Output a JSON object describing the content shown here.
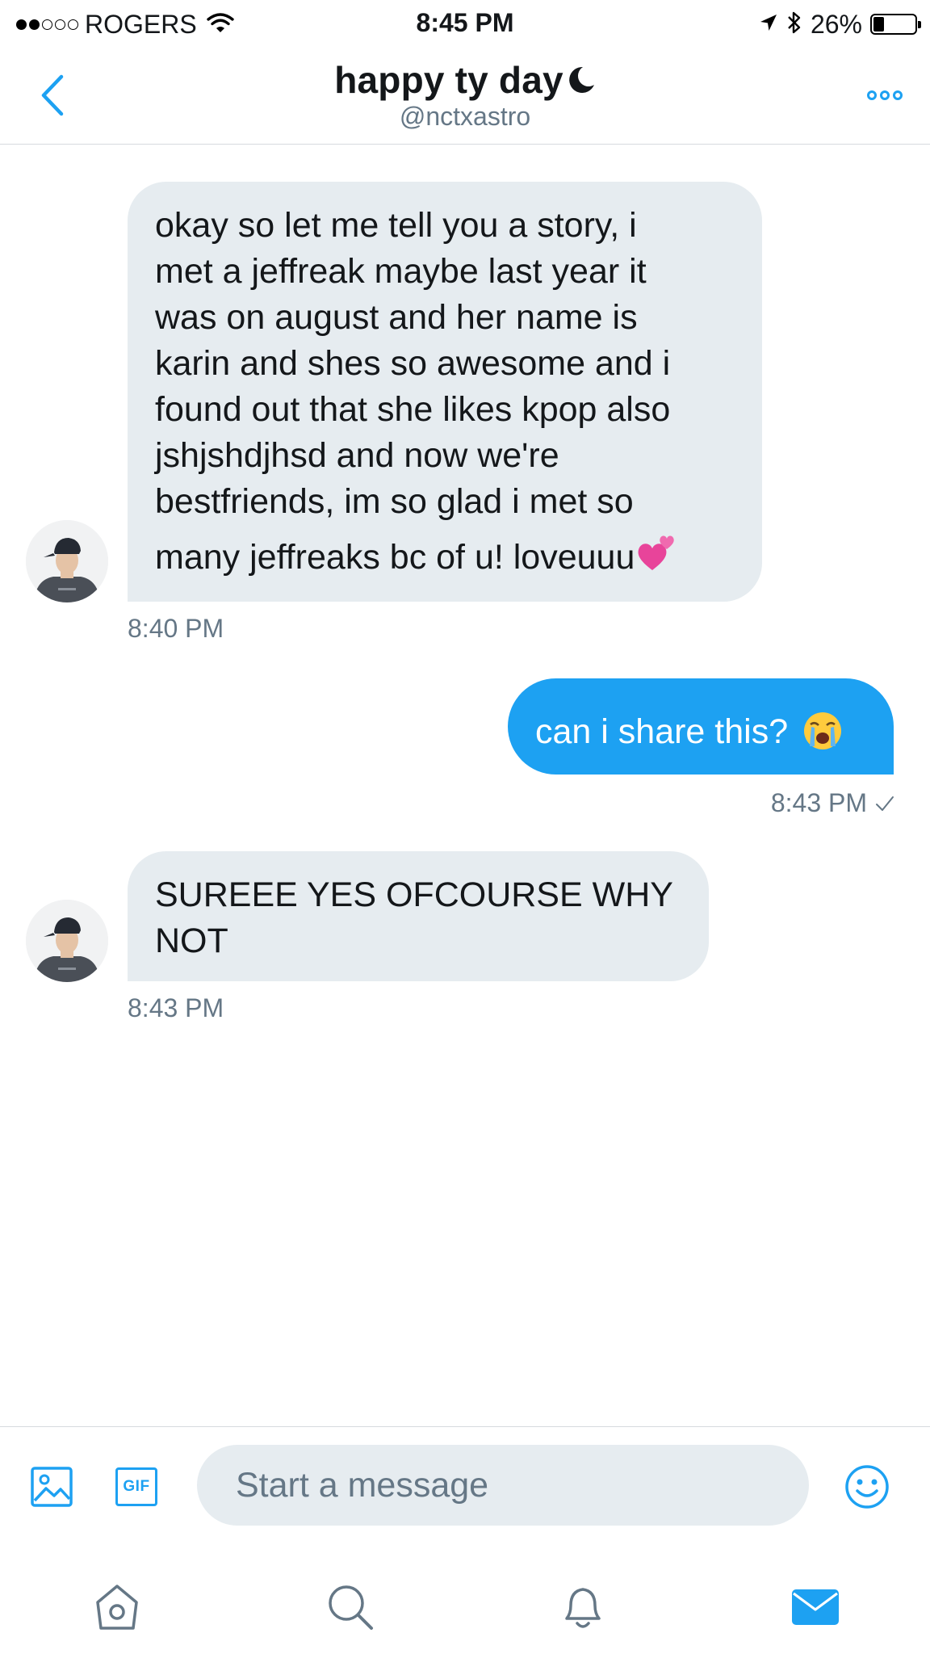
{
  "status_bar": {
    "carrier": "ROGERS",
    "signal_bars_full": 2,
    "signal_bars_total": 5,
    "time": "8:45 PM",
    "battery_percent": "26%",
    "battery_level": 0.26,
    "icons": [
      "wifi-icon",
      "location-arrow-icon",
      "bluetooth-icon",
      "battery-icon"
    ]
  },
  "header": {
    "title": "happy ty day",
    "title_suffix_icon": "crescent-moon-icon",
    "handle": "@nctxastro",
    "back_icon": "chevron-left-icon",
    "more_icon": "more-dots-icon"
  },
  "messages": [
    {
      "direction": "incoming",
      "lines": [
        "okay so let me tell you a story, i",
        "met a jeffreak maybe last year it",
        "was on august and her name is",
        "karin and shes so awesome and i",
        "found out that she likes kpop also",
        "jshjshdjhsd and now we're",
        "bestfriends, im so glad i met so",
        "many jeffreaks bc of u! loveuuu"
      ],
      "emoji": "two-hearts-emoji",
      "time": "8:40 PM"
    },
    {
      "direction": "outgoing",
      "text": "can i share this?",
      "emoji": "loudly-crying-face-emoji",
      "time": "8:43 PM",
      "status_icon": "checkmark-icon"
    },
    {
      "direction": "incoming",
      "lines": [
        "SUREEE YES OFCOURSE WHY",
        "NOT"
      ],
      "time": "8:43 PM"
    }
  ],
  "compose": {
    "placeholder": "Start a message",
    "gif_label": "GIF",
    "icons": [
      "image-icon",
      "gif-icon",
      "emoji-smile-icon"
    ]
  },
  "tab_bar": {
    "tabs": [
      "home-icon",
      "search-icon",
      "notifications-bell-icon",
      "messages-envelope-icon"
    ],
    "active": "messages-envelope-icon"
  },
  "colors": {
    "accent": "#1da1f2",
    "bubble_incoming": "#e6ecf0",
    "secondary_text": "#657786",
    "primary_text": "#14171a"
  }
}
